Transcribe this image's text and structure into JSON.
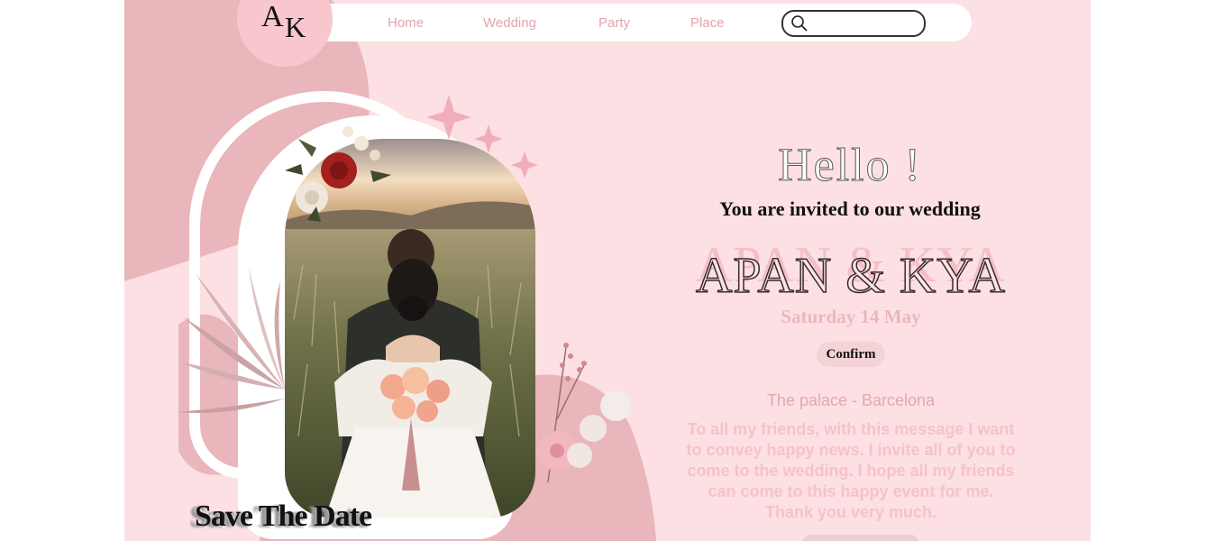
{
  "logo": {
    "letter_a": "A",
    "letter_k": "K"
  },
  "nav": {
    "items": [
      "Home",
      "Wedding",
      "Party",
      "Place"
    ],
    "search_placeholder": ""
  },
  "card": {
    "save_the_date": "Save The Date"
  },
  "invitation": {
    "greeting": "Hello !",
    "subtitle": "You are invited to our wedding",
    "couple": "APAN & KYA",
    "date": "Saturday 14 May",
    "confirm_label": "Confirm",
    "venue": "The palace - Barcelona",
    "message": "To all my friends, with this message I want to convey happy news. I invite all of you to come to the wedding. I hope all my friends can come to this happy event for me. Thank you very much."
  },
  "colors": {
    "page_bg": "#fce0e3",
    "accent_pink": "#e9b6bb",
    "nav_text": "#e2a4ab",
    "text_dark": "#111111"
  },
  "icons": [
    "search-icon",
    "sparkle-icon",
    "flower-bouquet-icon",
    "dried-palm-leaf-icon",
    "blossom-branch-icon"
  ]
}
